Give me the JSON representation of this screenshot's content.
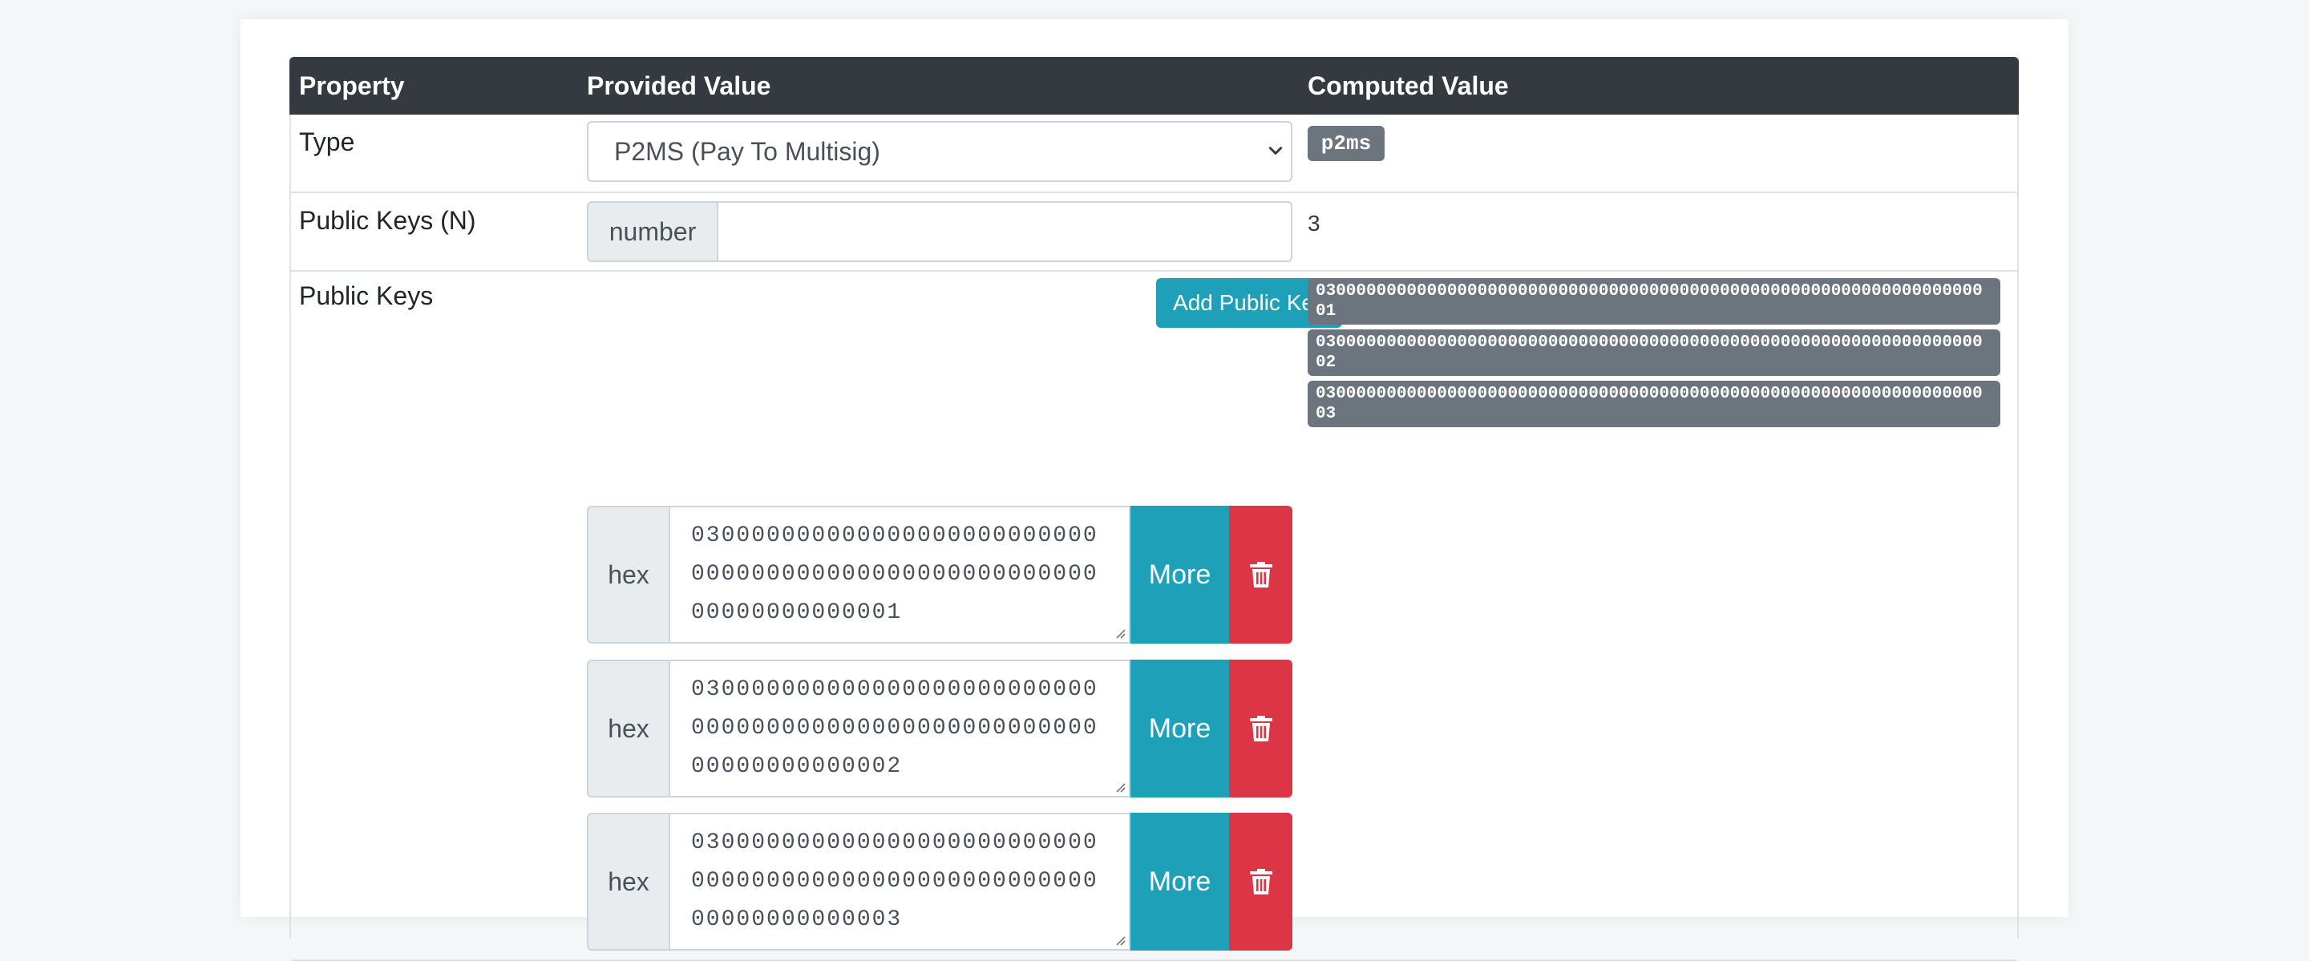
{
  "table": {
    "headers": [
      "Property",
      "Provided Value",
      "Computed Value"
    ]
  },
  "type_row": {
    "label": "Type",
    "select_value": "P2MS (Pay To Multisig)",
    "computed": "p2ms"
  },
  "n_row": {
    "label": "Public Keys (N)",
    "addon": "number",
    "input_value": "",
    "computed": "3"
  },
  "keys_row": {
    "label": "Public Keys",
    "add_button": "Add Public Key",
    "computed_keys": [
      "03000000000000000000000000000000000000000000000000000000000000000001",
      "03000000000000000000000000000000000000000000000000000000000000000002",
      "03000000000000000000000000000000000000000000000000000000000000000003"
    ],
    "entries": [
      {
        "addon": "hex",
        "value": "03000000000000000000000000000000000000000000000000000000000000000001",
        "more": "More"
      },
      {
        "addon": "hex",
        "value": "03000000000000000000000000000000000000000000000000000000000000000002",
        "more": "More"
      },
      {
        "addon": "hex",
        "value": "03000000000000000000000000000000000000000000000000000000000000000003",
        "more": "More"
      }
    ]
  },
  "icons": {
    "delete": "trash-icon",
    "select": "chevron-down-icon"
  },
  "colors": {
    "header_bg": "#343a40",
    "info": "#1ea1b8",
    "danger": "#dc3545",
    "secondary": "#6c757d"
  }
}
